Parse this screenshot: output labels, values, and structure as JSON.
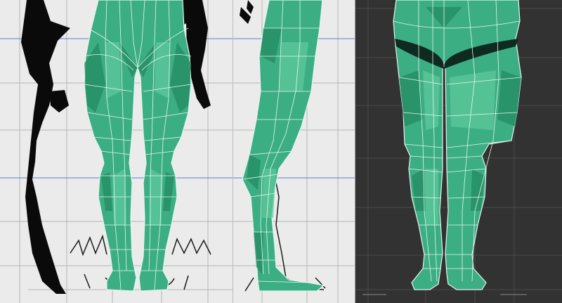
{
  "colors": {
    "ortho_background": "#ebebeb",
    "perspective_background": "#323232",
    "grid_light": "#b4b4b4",
    "grid_dark": "#4a4a4a",
    "guide_line": "#5a7fc8",
    "mesh_fill": "#3cae84",
    "mesh_dark": "#238a62",
    "mesh_light": "#5fcb9e",
    "wire": "#e6f5ee",
    "reference_ink": "#0a0a0a"
  },
  "viewports": [
    {
      "id": "front",
      "projection": "orthographic-front"
    },
    {
      "id": "side",
      "projection": "orthographic-side"
    },
    {
      "id": "perspective",
      "projection": "perspective"
    }
  ],
  "icons": {
    "model": "leg-mesh-model",
    "reference": "reference-sketch"
  }
}
